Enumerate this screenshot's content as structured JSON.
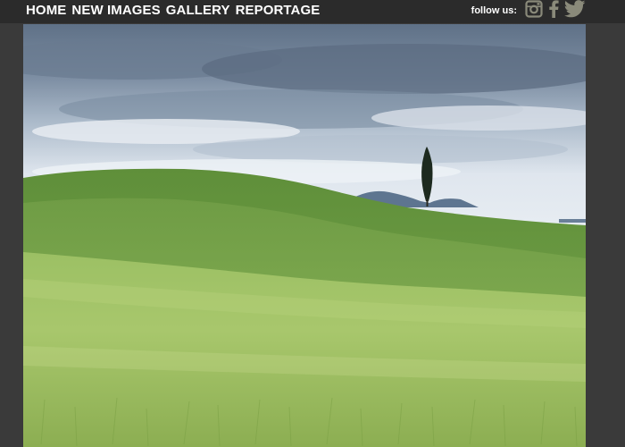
{
  "nav": {
    "items": [
      {
        "label": "HOME"
      },
      {
        "label": "NEW IMAGES"
      },
      {
        "label": "GALLERY"
      },
      {
        "label": "REPORTAGE"
      }
    ]
  },
  "social": {
    "follow_label": "follow us:",
    "icons": [
      "instagram-icon",
      "facebook-icon",
      "twitter-icon"
    ]
  },
  "hero": {
    "subject": "rolling green hills with a lone cypress tree under a cloudy sky"
  },
  "colors": {
    "page_bg": "#3a3a3a",
    "topbar_bg": "#2b2b2b",
    "icon_color": "#8a8a7a",
    "text": "#ffffff"
  }
}
